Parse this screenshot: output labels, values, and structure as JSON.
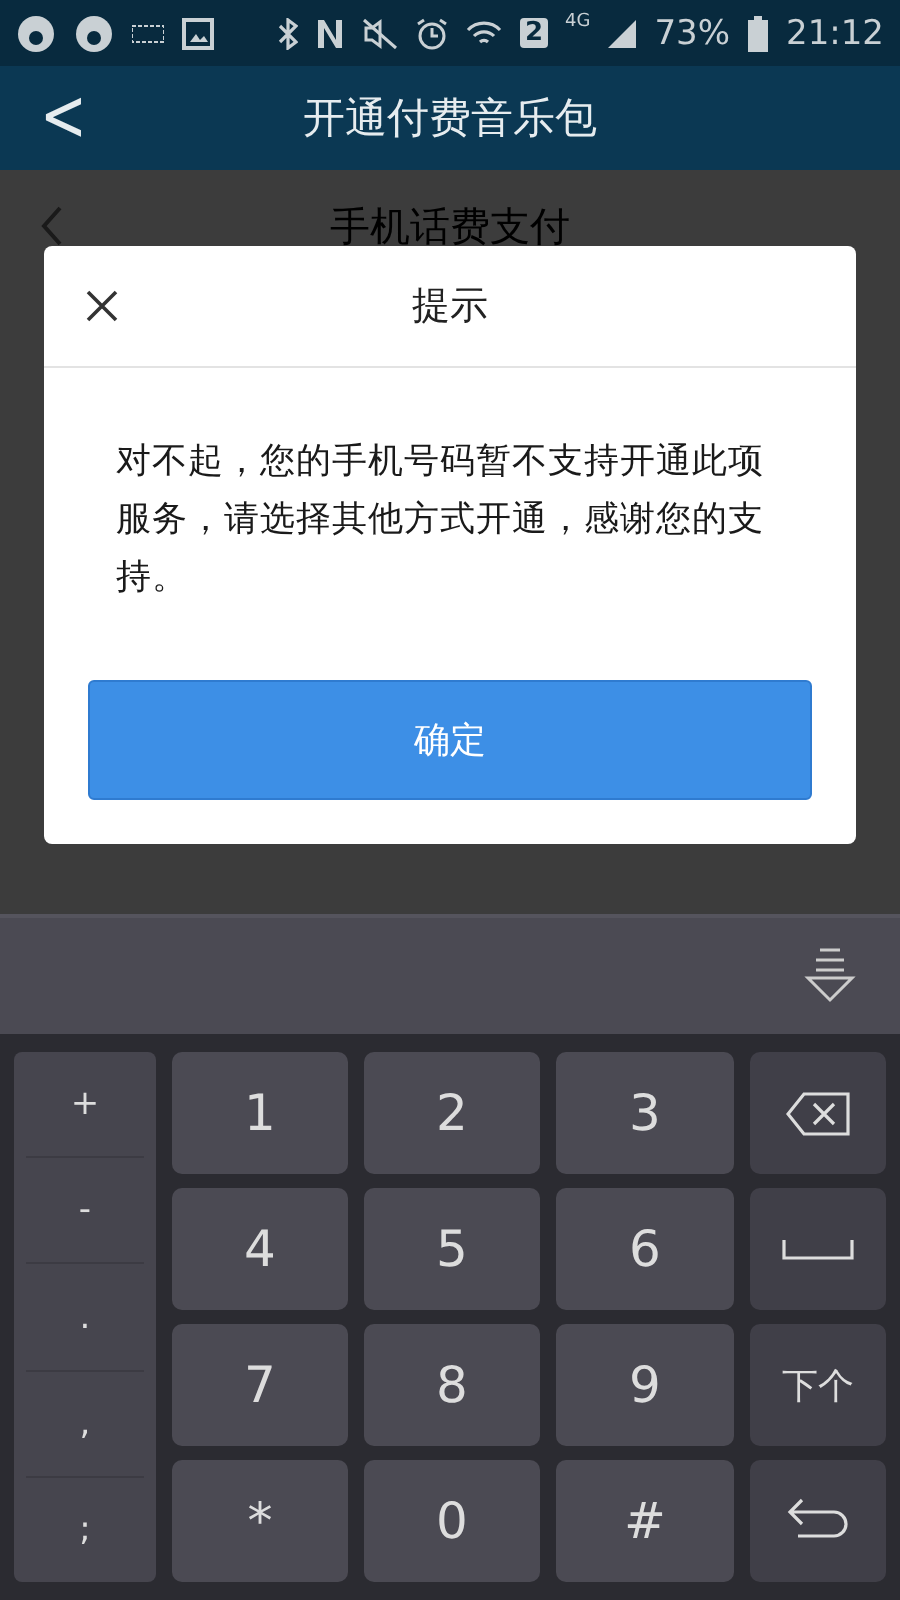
{
  "status_bar": {
    "sim": "2",
    "network": "4G",
    "battery": "73%",
    "time": "21:12"
  },
  "header": {
    "back": "<",
    "title": "开通付费音乐包"
  },
  "background_page": {
    "title": "手机话费支付"
  },
  "dialog": {
    "title": "提示",
    "message": "对不起，您的手机号码暂不支持开通此项服务，请选择其他方式开通，感谢您的支持。",
    "button": "确定"
  },
  "keyboard": {
    "symbols": [
      "+",
      "-",
      ".",
      ",",
      ";"
    ],
    "keys": [
      {
        "kind": "text",
        "label": "1"
      },
      {
        "kind": "text",
        "label": "2"
      },
      {
        "kind": "text",
        "label": "3"
      },
      {
        "kind": "backspace"
      },
      {
        "kind": "text",
        "label": "4"
      },
      {
        "kind": "text",
        "label": "5"
      },
      {
        "kind": "text",
        "label": "6"
      },
      {
        "kind": "space"
      },
      {
        "kind": "text",
        "label": "7"
      },
      {
        "kind": "text",
        "label": "8"
      },
      {
        "kind": "text",
        "label": "9"
      },
      {
        "kind": "next",
        "label": "下个"
      },
      {
        "kind": "text",
        "label": "*"
      },
      {
        "kind": "text",
        "label": "0"
      },
      {
        "kind": "text",
        "label": "#"
      },
      {
        "kind": "enter"
      }
    ]
  }
}
